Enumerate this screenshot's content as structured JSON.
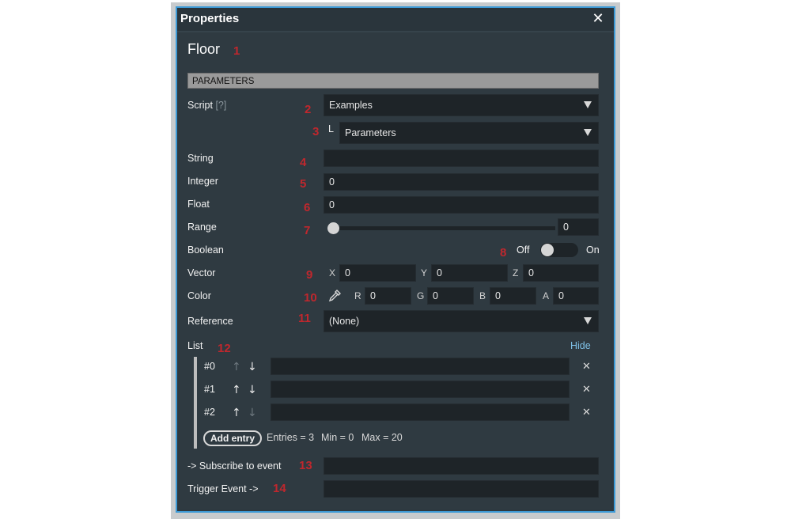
{
  "window": {
    "title": "Properties",
    "close_icon": "close-icon"
  },
  "object": {
    "name": "Floor",
    "marker": "1"
  },
  "section": {
    "title": "PARAMETERS"
  },
  "rows": {
    "script": {
      "label": "Script",
      "help": "[?]",
      "marker": "2",
      "value": "Examples",
      "icon": "dropdown-arrow-icon"
    },
    "sub_script": {
      "prefix": "L",
      "marker": "3",
      "value": "Parameters",
      "icon": "dropdown-arrow-icon"
    },
    "string": {
      "label": "String",
      "marker": "4",
      "value": ""
    },
    "integer": {
      "label": "Integer",
      "marker": "5",
      "value": "0"
    },
    "float": {
      "label": "Float",
      "marker": "6",
      "value": "0"
    },
    "range": {
      "label": "Range",
      "marker": "7",
      "value": "0",
      "slider_fraction": 0
    },
    "boolean": {
      "label": "Boolean",
      "marker": "8",
      "off_label": "Off",
      "on_label": "On",
      "state": false
    },
    "vector": {
      "label": "Vector",
      "marker": "9",
      "x_label": "X",
      "x": "0",
      "y_label": "Y",
      "y": "0",
      "z_label": "Z",
      "z": "0"
    },
    "color": {
      "label": "Color",
      "marker": "10",
      "picker_icon": "eyedropper-icon",
      "r_label": "R",
      "r": "0",
      "g_label": "G",
      "g": "0",
      "b_label": "B",
      "b": "0",
      "a_label": "A",
      "a": "0"
    },
    "reference": {
      "label": "Reference",
      "marker": "11",
      "value": "(None)",
      "icon": "dropdown-arrow-icon"
    },
    "list": {
      "label": "List",
      "marker": "12",
      "hide_label": "Hide",
      "items": [
        {
          "index": "#0",
          "value": "",
          "up_enabled": false,
          "down_enabled": true
        },
        {
          "index": "#1",
          "value": "",
          "up_enabled": true,
          "down_enabled": true
        },
        {
          "index": "#2",
          "value": "",
          "up_enabled": true,
          "down_enabled": false
        }
      ],
      "up_glyph": "↑",
      "down_glyph": "↓",
      "remove_glyph": "✕",
      "add_entry_label": "Add entry",
      "entries_text": "Entries = 3",
      "min_text": "Min = 0",
      "max_text": "Max = 20"
    },
    "subscribe": {
      "label": "-> Subscribe to event",
      "marker": "13",
      "value": ""
    },
    "trigger": {
      "label": "Trigger  Event ->",
      "marker": "14",
      "value": ""
    }
  },
  "colors": {
    "accent_border": "#3d9ad6",
    "marker_red": "#c0272d",
    "link_blue": "#7ec0e6",
    "panel_bg": "#2f3a41",
    "field_bg": "#1e2428"
  }
}
